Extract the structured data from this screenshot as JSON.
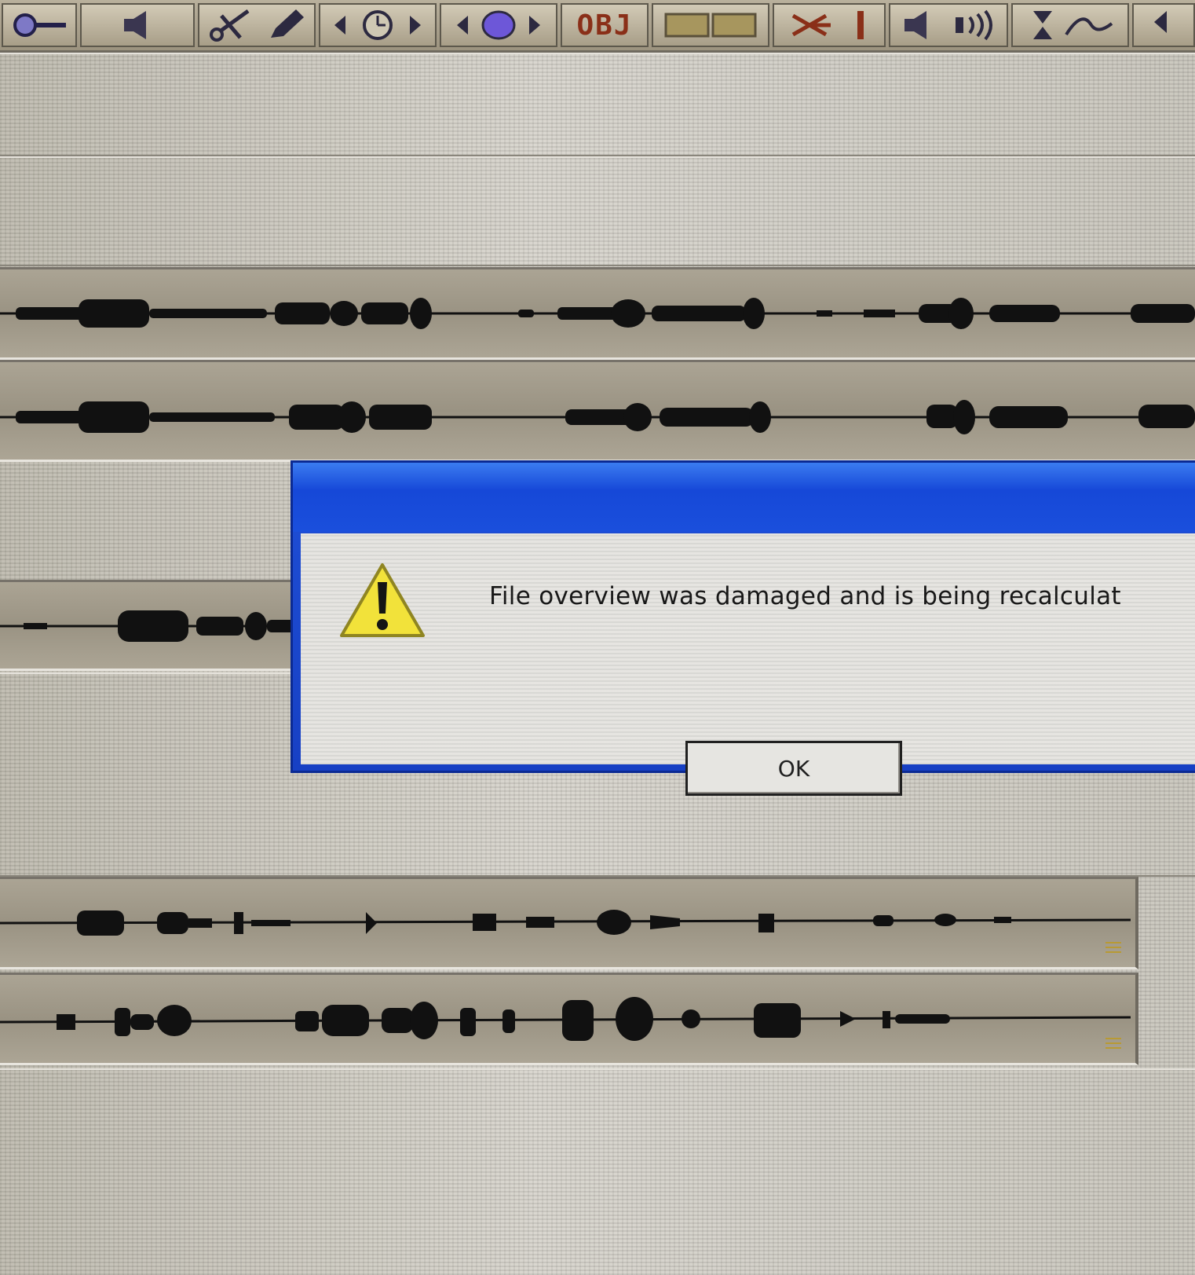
{
  "toolbar": {
    "obj_label": "OBJ"
  },
  "dialog": {
    "message": "File overview was damaged and is being recalculat",
    "ok_label": "OK"
  },
  "colors": {
    "dialog_blue": "#1a4fdc",
    "warning_yellow": "#f2e23a",
    "waveform": "#111111"
  },
  "icons": [
    "zoom-icon",
    "speaker-icon",
    "scissors-icon",
    "pencil-icon",
    "clock-icon",
    "scrub-icon",
    "speaker-icon",
    "audio-wave-icon",
    "fade-icon",
    "warning-icon"
  ]
}
